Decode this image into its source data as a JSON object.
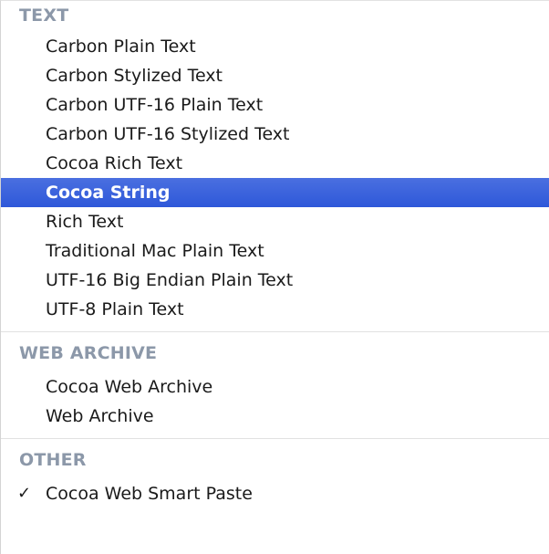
{
  "menu": {
    "sections": [
      {
        "header": "TEXT",
        "items": [
          "Carbon Plain Text",
          "Carbon Stylized Text",
          "Carbon UTF-16 Plain Text",
          "Carbon UTF-16 Stylized Text",
          "Cocoa Rich Text",
          "Cocoa String",
          "Rich Text",
          "Traditional Mac Plain Text",
          "UTF-16 Big Endian Plain Text",
          "UTF-8 Plain Text"
        ]
      },
      {
        "header": "WEB ARCHIVE",
        "items": [
          "Cocoa Web Archive",
          "Web Archive"
        ]
      },
      {
        "header": "OTHER",
        "items": [
          "Cocoa Web Smart Paste"
        ]
      }
    ],
    "highlighted_item": "Cocoa String",
    "checked_item": "Cocoa Web Smart Paste",
    "check_glyph": "✓",
    "highlight_color": "#3661dc"
  }
}
